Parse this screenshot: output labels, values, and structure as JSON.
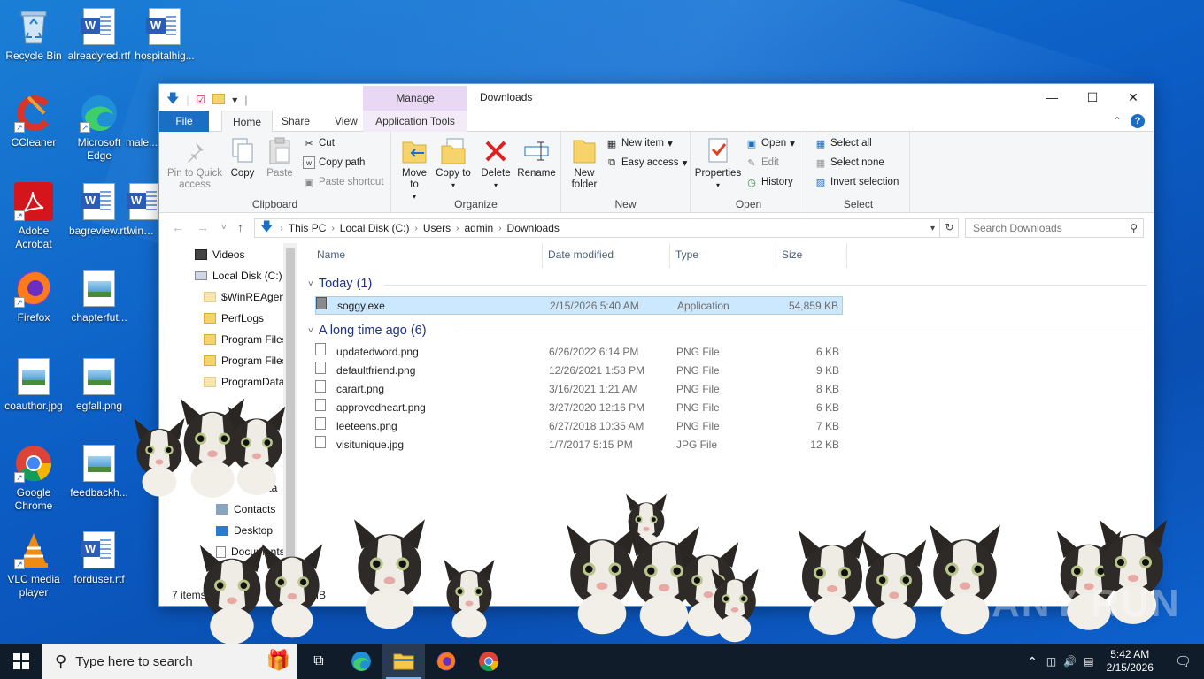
{
  "desktop": {
    "icons": [
      {
        "label": "Recycle Bin",
        "icon": "recycle-bin-icon"
      },
      {
        "label": "alreadyred.rtf",
        "icon": "word-doc-icon"
      },
      {
        "label": "hospitalhig...",
        "icon": "word-doc-icon"
      },
      {
        "label": "CCleaner",
        "icon": "ccleaner-icon"
      },
      {
        "label": "Microsoft Edge",
        "icon": "edge-icon"
      },
      {
        "label": "male...",
        "icon": "file-icon"
      },
      {
        "label": "Adobe Acrobat",
        "icon": "acrobat-icon"
      },
      {
        "label": "bagreview.rtf",
        "icon": "word-doc-icon"
      },
      {
        "label": "wine...",
        "icon": "word-doc-icon"
      },
      {
        "label": "Firefox",
        "icon": "firefox-icon"
      },
      {
        "label": "chapterfut...",
        "icon": "image-file-icon"
      },
      {
        "label": "coauthor.jpg",
        "icon": "image-file-icon"
      },
      {
        "label": "egfall.png",
        "icon": "image-file-icon"
      },
      {
        "label": "Google Chrome",
        "icon": "chrome-icon"
      },
      {
        "label": "feedbackh...",
        "icon": "image-file-icon"
      },
      {
        "label": "VLC media player",
        "icon": "vlc-icon"
      },
      {
        "label": "forduser.rtf",
        "icon": "word-doc-icon"
      }
    ]
  },
  "explorer": {
    "title": "Downloads",
    "context_tab": "Manage",
    "tabs": {
      "file": "File",
      "home": "Home",
      "share": "Share",
      "view": "View",
      "app_tools": "Application Tools"
    },
    "ribbon": {
      "clipboard": {
        "title": "Clipboard",
        "pin": "Pin to Quick access",
        "copy": "Copy",
        "paste": "Paste",
        "cut": "Cut",
        "copy_path": "Copy path",
        "paste_shortcut": "Paste shortcut"
      },
      "organize": {
        "title": "Organize",
        "move_to": "Move to",
        "copy_to": "Copy to",
        "delete": "Delete",
        "rename": "Rename"
      },
      "new": {
        "title": "New",
        "new_folder": "New folder",
        "new_item": "New item",
        "easy_access": "Easy access"
      },
      "open": {
        "title": "Open",
        "properties": "Properties",
        "open": "Open",
        "edit": "Edit",
        "history": "History"
      },
      "select": {
        "title": "Select",
        "select_all": "Select all",
        "select_none": "Select none",
        "invert": "Invert selection"
      }
    },
    "address": {
      "crumbs": [
        "This PC",
        "Local Disk (C:)",
        "Users",
        "admin",
        "Downloads"
      ],
      "search_placeholder": "Search Downloads"
    },
    "nav": [
      {
        "label": "Videos"
      },
      {
        "label": "Local Disk (C:)"
      },
      {
        "label": "$WinREAgent"
      },
      {
        "label": "PerfLogs"
      },
      {
        "label": "Program Files"
      },
      {
        "label": "Program Files"
      },
      {
        "label": "ProgramData"
      },
      {
        "label": "Data"
      },
      {
        "label": "Contacts"
      },
      {
        "label": "Desktop"
      },
      {
        "label": "Documents"
      }
    ],
    "columns": {
      "name": "Name",
      "date": "Date modified",
      "type": "Type",
      "size": "Size"
    },
    "groups": [
      {
        "header": "Today (1)",
        "files": [
          {
            "name": "soggy.exe",
            "date": "2/15/2026 5:40 AM",
            "type": "Application",
            "size": "54,859 KB"
          }
        ]
      },
      {
        "header": "A long time ago (6)",
        "files": [
          {
            "name": "updatedword.png",
            "date": "6/26/2022 6:14 PM",
            "type": "PNG File",
            "size": "6 KB"
          },
          {
            "name": "defaultfriend.png",
            "date": "12/26/2021 1:58 PM",
            "type": "PNG File",
            "size": "9 KB"
          },
          {
            "name": "carart.png",
            "date": "3/16/2021 1:21 AM",
            "type": "PNG File",
            "size": "8 KB"
          },
          {
            "name": "approvedheart.png",
            "date": "3/27/2020 12:16 PM",
            "type": "PNG File",
            "size": "6 KB"
          },
          {
            "name": "leeteens.png",
            "date": "6/27/2018 10:35 AM",
            "type": "PNG File",
            "size": "7 KB"
          },
          {
            "name": "visitunique.jpg",
            "date": "1/7/2017 5:15 PM",
            "type": "JPG File",
            "size": "12 KB"
          }
        ]
      }
    ],
    "status": {
      "items": "7 items",
      "size_suffix": "5 MB"
    }
  },
  "taskbar": {
    "search_placeholder": "Type here to search",
    "time": "5:42 AM",
    "date": "2/15/2026",
    "apps": [
      "task-view-icon",
      "edge-icon",
      "file-explorer-icon",
      "firefox-icon",
      "chrome-icon"
    ]
  },
  "watermark": "ANY RUN"
}
